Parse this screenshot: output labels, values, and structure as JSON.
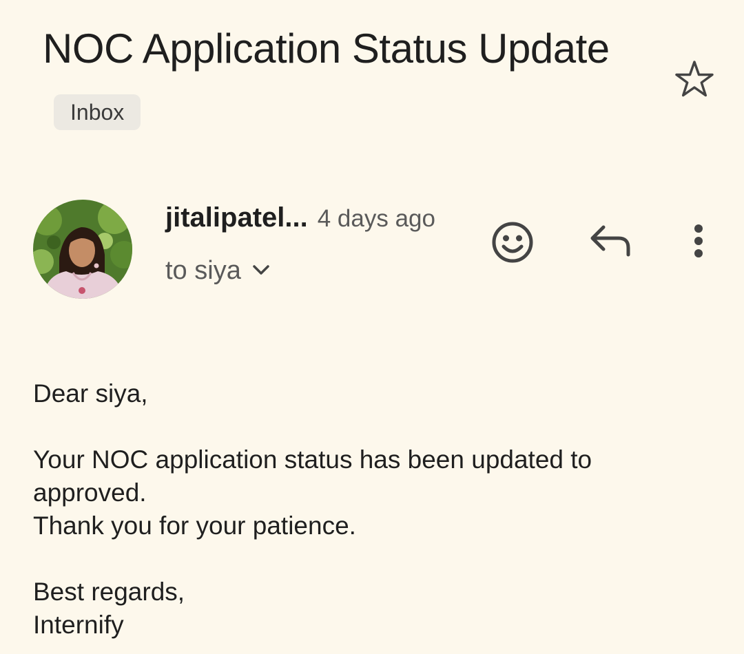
{
  "email": {
    "subject": "NOC Application Status Update",
    "label": "Inbox",
    "starred": false,
    "sender": {
      "name": "jitalipatel...",
      "time": "4 days ago",
      "recipient": "to siya"
    },
    "actions": {
      "emoji_icon": "smiley-face-icon",
      "reply_icon": "reply-arrow-icon",
      "more_icon": "more-vert-icon"
    },
    "body": {
      "greeting": "Dear siya,",
      "line1": "Your NOC application status has been updated to approved.",
      "line2": "Thank you for your patience.",
      "closing": "Best regards,",
      "signature": "Internify"
    }
  },
  "colors": {
    "background": "#fdf8ec",
    "text_primary": "#1f1f1f",
    "text_secondary": "#5a5a5a",
    "chip_background": "#ece9e2",
    "icon": "#444444"
  }
}
